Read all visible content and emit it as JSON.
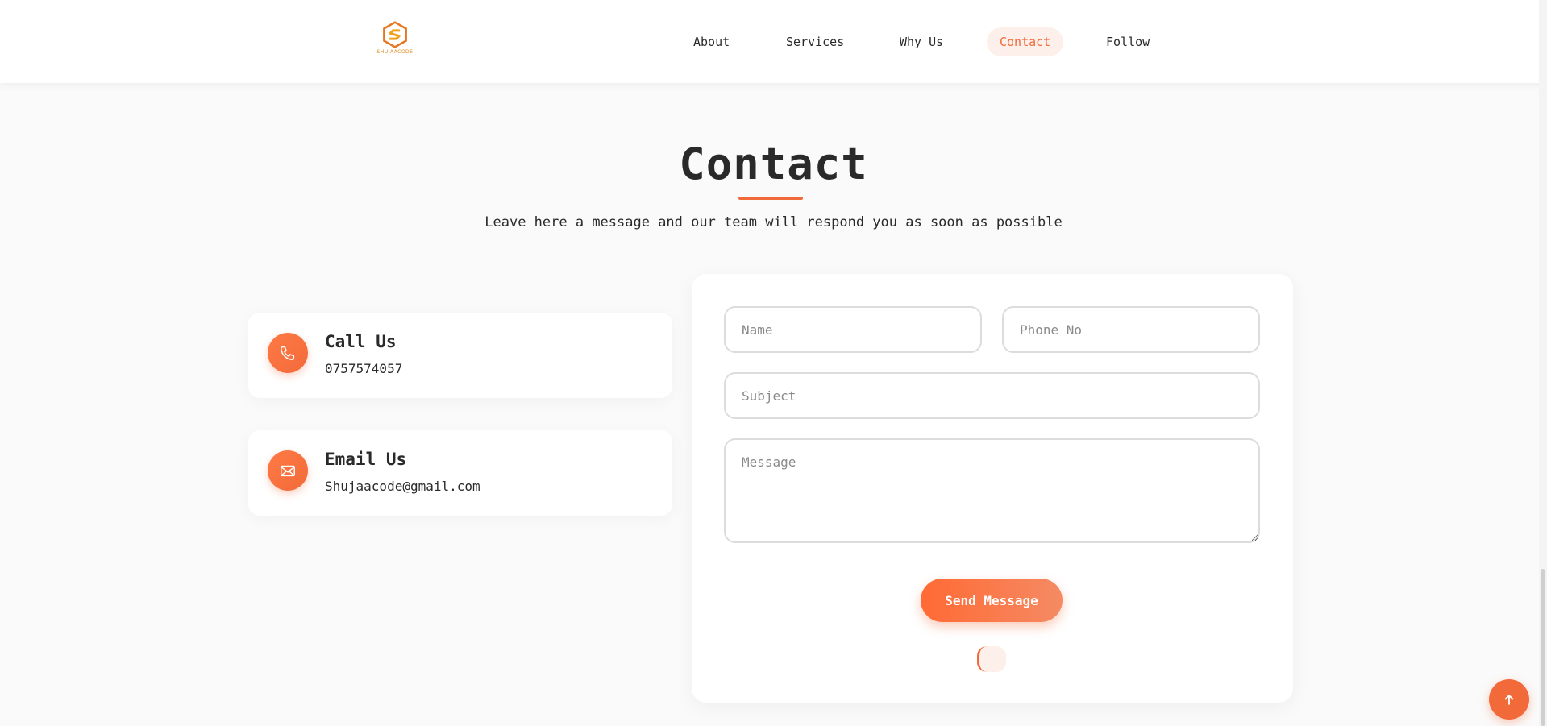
{
  "header": {
    "logo_text": "SHUJAACODE",
    "nav": [
      {
        "label": "About",
        "active": false
      },
      {
        "label": "Services",
        "active": false
      },
      {
        "label": "Why Us",
        "active": false
      },
      {
        "label": "Contact",
        "active": true
      },
      {
        "label": "Follow",
        "active": false
      }
    ]
  },
  "section": {
    "title": "Contact",
    "subtitle": "Leave here a message and our team will respond you as soon as possible"
  },
  "info_cards": [
    {
      "icon": "phone-icon",
      "title": "Call Us",
      "value": "0757574057"
    },
    {
      "icon": "envelope-icon",
      "title": "Email Us",
      "value": "Shujaacode@gmail.com"
    }
  ],
  "form": {
    "name_placeholder": "Name",
    "phone_placeholder": "Phone No",
    "subject_placeholder": "Subject",
    "message_placeholder": "Message",
    "submit_label": "Send Message"
  },
  "colors": {
    "accent": "#f26a3a",
    "accent_light": "#fdf0ea",
    "text": "#2a2a2a",
    "background": "#fafafa"
  }
}
